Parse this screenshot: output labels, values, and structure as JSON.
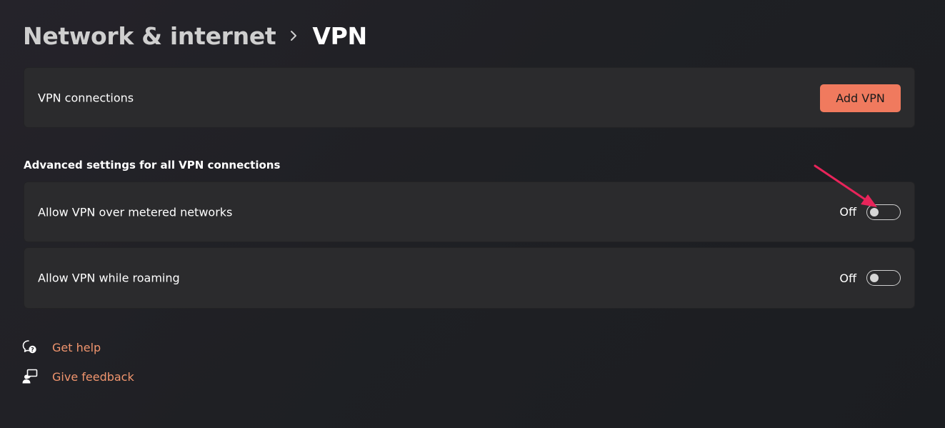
{
  "breadcrumb": {
    "parent": "Network & internet",
    "current": "VPN"
  },
  "vpn_connections": {
    "label": "VPN connections",
    "add_button": "Add VPN"
  },
  "advanced": {
    "title": "Advanced settings for all VPN connections",
    "settings": [
      {
        "label": "Allow VPN over metered networks",
        "state": "Off",
        "on": false
      },
      {
        "label": "Allow VPN while roaming",
        "state": "Off",
        "on": false
      }
    ]
  },
  "links": {
    "help": "Get help",
    "feedback": "Give feedback"
  },
  "colors": {
    "accent": "#f07a5e",
    "link": "#f0956e",
    "annotation_arrow": "#e8245a"
  }
}
